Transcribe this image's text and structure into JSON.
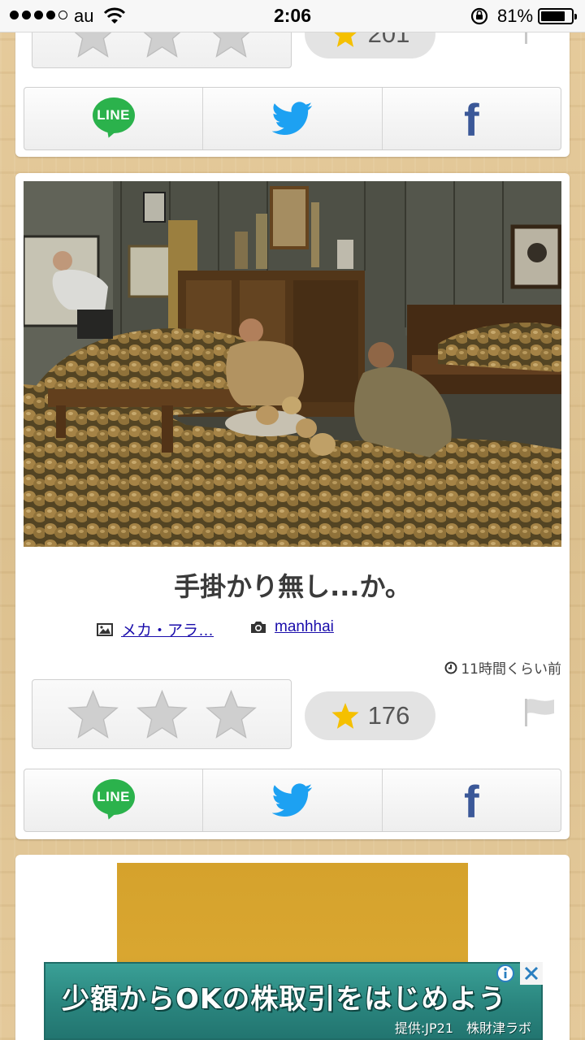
{
  "status_bar": {
    "carrier": "au",
    "time": "2:06",
    "battery_percent": "81%",
    "battery_level": 0.81,
    "signal_bars_filled": 4
  },
  "posts": [
    {
      "like_count": "201",
      "share": {
        "line_label": "LINE"
      }
    },
    {
      "title": "手掛かり無し...か。",
      "source_label": "メカ・アラ…",
      "photographer": "manhhai",
      "time_ago": "11時間くらい前",
      "like_count": "176",
      "share": {
        "line_label": "LINE"
      }
    }
  ],
  "ad": {
    "headline": "少額からOKの株取引をはじめよう",
    "sponsor": "提供:JP21　株財津ラボ"
  },
  "colors": {
    "line_green": "#2bb24c",
    "twitter_blue": "#1da1f2",
    "facebook_blue": "#3b5898",
    "star_gold": "#f5c000",
    "star_gray": "#cfcfcf",
    "ad_teal": "#2c8a82"
  },
  "icons": [
    "star-icon",
    "flag-icon",
    "line-icon",
    "twitter-bird-icon",
    "facebook-icon",
    "image-icon",
    "camera-icon",
    "clock-icon",
    "info-icon",
    "close-icon",
    "wifi-icon",
    "rotation-lock-icon"
  ]
}
